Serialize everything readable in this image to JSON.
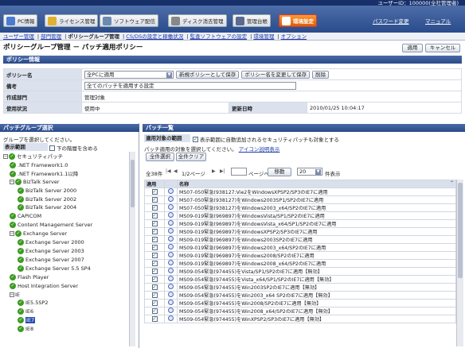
{
  "header": {
    "user_id": "ユーザーID：100000(全社管理者)",
    "tabs": [
      "PC情報",
      "ライセンス管理",
      "ソフトウェア配信",
      "ディスク消去管理",
      "管理台帳",
      "環境設定"
    ],
    "password_link": "パスワード変更",
    "manual_link": "マニュアル"
  },
  "subnav": [
    "ユーザー管理",
    "部門管理",
    "ポリシーグループ管理",
    "CS/DSの設定と稼働状況",
    "監査ソフトウェアの設定",
    "環境管理",
    "オプション"
  ],
  "page_title": "ポリシーグループ管理 － パッチ適用ポリシー",
  "buttons": {
    "apply": "適用",
    "cancel": "キャンセル"
  },
  "policy": {
    "section": "ポリシー情報",
    "name_label": "ポリシー名",
    "name_value": "全PCに適用",
    "save_new": "新規ポリシーとして保存",
    "rename_save": "ポリシー名を変更して保存",
    "delete": "削除",
    "note_label": "備考",
    "note_value": "全てのパッチを適用する設定",
    "dept_label": "作成部門",
    "dept_value": "管理対象",
    "status_label": "使用状況",
    "status_value": "使用中",
    "updated_label": "更新日時",
    "updated_value": "2010/01/25 10:04:17"
  },
  "left": {
    "section": "パッチグループ選択",
    "instruction": "グループを選択してください。",
    "range_label": "表示範囲",
    "include_lower": "下の階層を含める",
    "tree": [
      "セキュリティパッチ",
      ".NET Framework1.0",
      ".NET Framework1.1以降",
      "BizTalk Server",
      "BizTalk Server 2000",
      "BizTalk Server 2002",
      "BizTalk Server 2004",
      "CAPICOM",
      "Content Management Server",
      "Exchange Server",
      "Exchange Server 2000",
      "Exchange Server 2003",
      "Exchange Server 2007",
      "Exchange Server 5.5 SP4",
      "Flash Player",
      "Host Integration Server",
      "IE",
      "IE5.5SP2",
      "IE6",
      "IE7",
      "IE8"
    ]
  },
  "right": {
    "section": "パッチ一覧",
    "scope_label": "適用対象の範囲",
    "scope_check": "表示範囲に自動追加されるセキュリティパッチも対象とする",
    "instruction": "パッチ適用の対象を選択してください。",
    "icon_link": "アイコン説明表示",
    "select_all": "全件選択",
    "clear_all": "全件クリア",
    "count": "全38件",
    "pager": "1/2ページ",
    "page_suffix": "ページへ",
    "move": "移動",
    "per_page": "20",
    "per_page_suffix": "件表示",
    "col_apply": "適用",
    "col_name": "名称",
    "patches": [
      "MS07-050緊急(938127:Vie2をWindowsXPSP2/SP3のIE7に適用",
      "MS07-050緊急(938127)をWindows2003SP1/SP2のIE7に適用",
      "MS07-050緊急(938127)をWindows2003_x64/SP2のIE7に適用",
      "MS09-019緊急(969897)をWindowsVista/SP1/SP2のIE7に適用",
      "MS09-019緊急(969897)をWindowsVista_x64/SP1/SP2のIE7に適用",
      "MS09-019緊急(969897)をWindowsXPSP2/SP3のIE7に適用",
      "MS09-019緊急(969897)をWindows2003SP2のIE7に適用",
      "MS09-019緊急(969897)をWindows2003_x64/SP2のIE7に適用",
      "MS09-019緊急(969897)をWindows2008/SP2のIE7に適用",
      "MS09-019緊急(969897)をWindows2008_x64/SP2のIE7に適用",
      "MS09-054緊急(974455)をVista/SP1/SP2のIE7に適用【無効】",
      "MS09-054緊急(974455)をVista_x64/SP1/SP2のIE7に適用【無効】",
      "MS09-054緊急(974455)をWin2003SP2のIE7に適用【無効】",
      "MS09-054緊急(974455)をWin2003_x64 SP2のIE7に適用【無効】",
      "MS09-054緊急(974455)をWin2008/SP2のIE7に適用【無効】",
      "MS09-054緊急(974455)をWin2008_x64/SP2のIE7に適用【無効】",
      "MS09-054緊急(974455)をWinXPSP2/SP3のIE7に適用【無効】"
    ]
  },
  "colors": {
    "header_dark": "#17306a",
    "header_blue": "#2b4c8c",
    "active_tab": "#e05a00",
    "ok_green": "#3b9b1f"
  }
}
